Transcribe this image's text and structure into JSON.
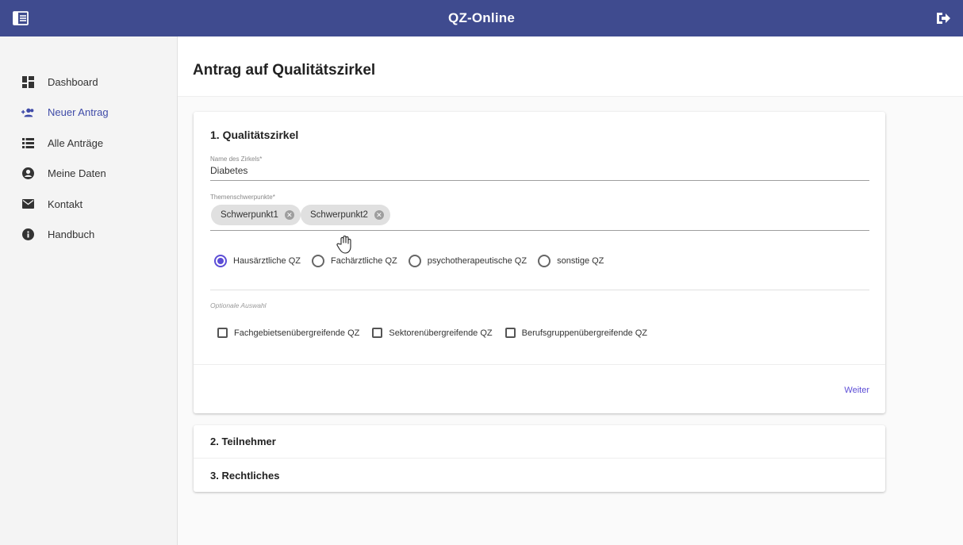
{
  "app": {
    "title": "QZ-Online"
  },
  "sidebar": {
    "items": [
      {
        "label": "Dashboard",
        "icon": "dashboard-icon"
      },
      {
        "label": "Neuer Antrag",
        "icon": "add-group-icon",
        "active": true
      },
      {
        "label": "Alle Anträge",
        "icon": "list-icon"
      },
      {
        "label": "Meine Daten",
        "icon": "account-icon"
      },
      {
        "label": "Kontakt",
        "icon": "mail-icon"
      },
      {
        "label": "Handbuch",
        "icon": "info-icon"
      }
    ]
  },
  "page": {
    "title": "Antrag auf Qualitätszirkel"
  },
  "form": {
    "section_title": "1. Qualitätszirkel",
    "name_label": "Name des Zirkels*",
    "name_value": "Diabetes",
    "topics_label": "Themenschwerpunkte*",
    "chips": [
      "Schwerpunkt1",
      "Schwerpunkt2"
    ],
    "radios": [
      {
        "label": "Hausärztliche QZ",
        "checked": true
      },
      {
        "label": "Fachärztliche QZ",
        "checked": false
      },
      {
        "label": "psychotherapeutische QZ",
        "checked": false
      },
      {
        "label": "sonstige QZ",
        "checked": false
      }
    ],
    "optional_label": "Optionale Auswahl",
    "checkboxes": [
      {
        "label": "Fachgebietsenübergreifende QZ",
        "checked": false
      },
      {
        "label": "Sektorenübergreifende QZ",
        "checked": false
      },
      {
        "label": "Berufsgruppenübergreifende QZ",
        "checked": false
      }
    ],
    "next_label": "Weiter"
  },
  "steps": [
    {
      "label": "2. Teilnehmer"
    },
    {
      "label": "3. Rechtliches"
    }
  ],
  "colors": {
    "topbar": "#3f4b8f",
    "accent": "#5c4dd6",
    "active_nav": "#3f4ba8"
  }
}
